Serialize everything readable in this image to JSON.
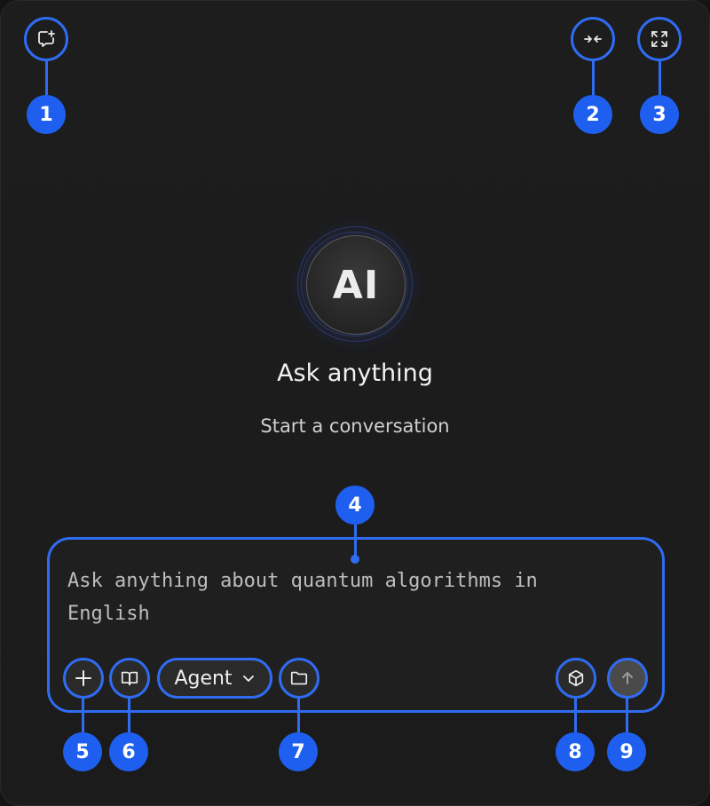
{
  "header": {
    "left_icon": "new-chat-icon",
    "right_icons": [
      "collapse-icon",
      "fullscreen-icon"
    ]
  },
  "hero": {
    "avatar_text": "AI",
    "title": "Ask anything",
    "subtitle": "Start a conversation"
  },
  "composer": {
    "placeholder": "Ask anything about quantum algorithms in English",
    "mode_label": "Agent",
    "icons": [
      "plus-icon",
      "book-icon",
      "folder-icon",
      "cube-icon",
      "arrow-up-icon"
    ]
  },
  "callouts": [
    "1",
    "2",
    "3",
    "4",
    "5",
    "6",
    "7",
    "8",
    "9"
  ],
  "colors": {
    "accent": "#1f5ff0",
    "background": "#1b1b1b",
    "text": "#f2f2f2"
  }
}
